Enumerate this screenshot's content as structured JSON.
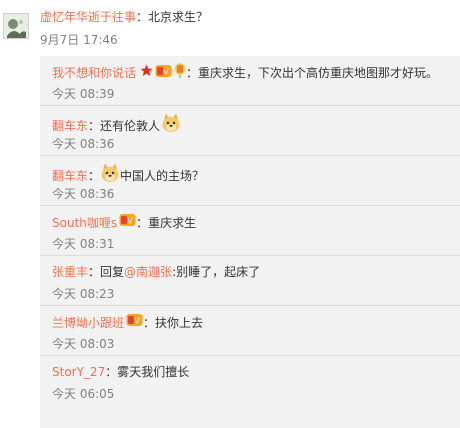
{
  "post": {
    "author": "虚忆年华逝于往事",
    "sep": "：",
    "text": "北京求生？",
    "time": "9月7日 17:46"
  },
  "replies": [
    {
      "author": "我不想和你说话",
      "badges": [
        "star-badge",
        "vip-badge",
        "balloon-badge"
      ],
      "sep": "：",
      "text": "重庆求生，下次出个高仿重庆地图那才好玩。",
      "time": "今天 08:39"
    },
    {
      "author": "翻车东",
      "sep": "：",
      "text": "还有伦敦人",
      "trailing_emoji": "doge-emoji",
      "time": "今天 08:36"
    },
    {
      "author": "翻车东",
      "sep": "：",
      "leading_emoji": "doge-emoji",
      "text": "中国人的主场？",
      "time": "今天 08:36"
    },
    {
      "author": "South咖喱s",
      "badges": [
        "vip-badge"
      ],
      "sep": "：",
      "text": "重庆求生",
      "time": "今天 08:31"
    },
    {
      "author": "张重丰",
      "sep": "：",
      "reply_prefix": "回复",
      "mention": "@南迦张",
      "text": ":别睡了，起床了",
      "time": "今天 08:23"
    },
    {
      "author": "兰博坳小跟班",
      "badges": [
        "vip-badge"
      ],
      "sep": "：",
      "text": "扶你上去",
      "time": "今天 08:03"
    },
    {
      "author": "StorY_27",
      "sep": "：",
      "text": "雾天我们擅长",
      "time": "今天 06:05"
    }
  ]
}
